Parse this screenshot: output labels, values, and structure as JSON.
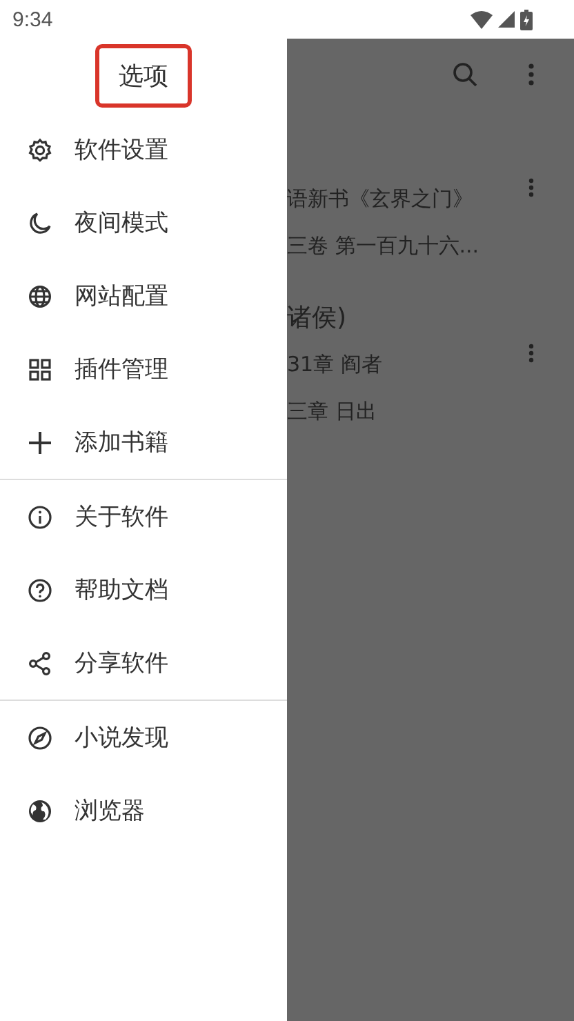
{
  "status_bar": {
    "time": "9:34"
  },
  "drawer": {
    "title": "选项",
    "title_highlighted": true,
    "groups": [
      [
        {
          "label": "软件设置"
        },
        {
          "label": "夜间模式"
        },
        {
          "label": "网站配置"
        },
        {
          "label": "插件管理"
        },
        {
          "label": "添加书籍"
        }
      ],
      [
        {
          "label": "关于软件"
        },
        {
          "label": "帮助文档"
        },
        {
          "label": "分享软件"
        }
      ],
      [
        {
          "label": "小说发现"
        },
        {
          "label": "浏览器"
        }
      ]
    ]
  },
  "background": {
    "books": [
      {
        "lines": [
          "语新书《玄界之门》",
          "三卷 第一百九十六..."
        ]
      },
      {
        "title": "诸侯)",
        "lines": [
          "31章 阎者",
          "三章 日出"
        ]
      }
    ]
  }
}
